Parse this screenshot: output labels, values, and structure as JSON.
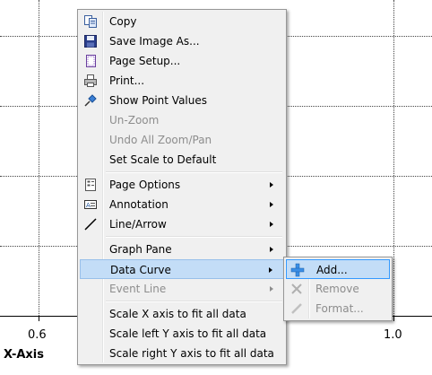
{
  "chart": {
    "x_tick_labels": [
      "0.6",
      "1.0"
    ],
    "x_axis_title": "X-Axis"
  },
  "context_menu": {
    "items": [
      {
        "label": "Copy",
        "icon": "copy-icon",
        "enabled": true
      },
      {
        "label": "Save Image As...",
        "icon": "save-icon",
        "enabled": true
      },
      {
        "label": "Page Setup...",
        "icon": "page-setup-icon",
        "enabled": true
      },
      {
        "label": "Print...",
        "icon": "print-icon",
        "enabled": true
      },
      {
        "label": "Show Point Values",
        "icon": "pin-icon",
        "enabled": true
      },
      {
        "label": "Un-Zoom",
        "icon": "",
        "enabled": false
      },
      {
        "label": "Undo All Zoom/Pan",
        "icon": "",
        "enabled": false
      },
      {
        "label": "Set Scale to Default",
        "icon": "",
        "enabled": true
      },
      {
        "label": "Page Options",
        "icon": "page-options-icon",
        "enabled": true,
        "submenu": true
      },
      {
        "label": "Annotation",
        "icon": "annotation-icon",
        "enabled": true,
        "submenu": true
      },
      {
        "label": "Line/Arrow",
        "icon": "line-icon",
        "enabled": true,
        "submenu": true
      },
      {
        "label": "Graph Pane",
        "icon": "",
        "enabled": true,
        "submenu": true
      },
      {
        "label": "Data Curve",
        "icon": "",
        "enabled": true,
        "submenu": true,
        "highlighted": true
      },
      {
        "label": "Event Line",
        "icon": "",
        "enabled": false,
        "submenu": true
      },
      {
        "label": "Scale X axis to fit all data",
        "icon": "",
        "enabled": true
      },
      {
        "label": "Scale left Y axis to fit all data",
        "icon": "",
        "enabled": true
      },
      {
        "label": "Scale right Y axis to fit all data",
        "icon": "",
        "enabled": true
      }
    ]
  },
  "submenu": {
    "items": [
      {
        "label": "Add...",
        "icon": "plus-icon",
        "enabled": true,
        "highlighted": true
      },
      {
        "label": "Remove",
        "icon": "remove-icon",
        "enabled": false
      },
      {
        "label": "Format...",
        "icon": "pencil-icon",
        "enabled": false
      }
    ]
  },
  "colors": {
    "menu_bg": "#f0f0f0",
    "highlight_bg": "#c3ddf7",
    "highlight_border": "#3399ff",
    "disabled_text": "#8d8d8d"
  }
}
